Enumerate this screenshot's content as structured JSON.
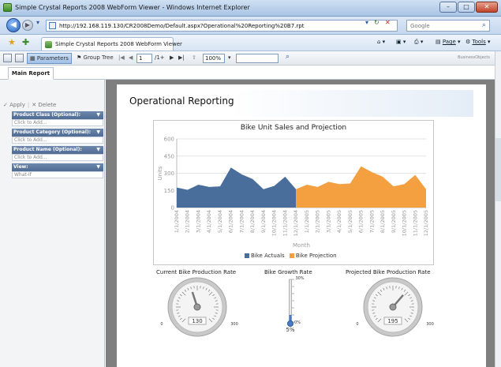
{
  "window": {
    "title": "Simple Crystal Reports 2008 WebForm Viewer - Windows Internet Explorer",
    "url": "http://192.168.119.130/CR2008Demo/Default.aspx?Operational%20Reporting%20B7.rpt",
    "search_placeholder": "Google",
    "tab_label": "Simple Crystal Reports 2008 WebForm Viewer",
    "cmd_page": "Page",
    "cmd_tools": "Tools"
  },
  "viewer_toolbar": {
    "parameters_label": "Parameters",
    "group_tree_label": "Group Tree",
    "page_value": "1",
    "page_total": "/1+",
    "zoom_value": "100%",
    "logo_prefix": "BusinessObjects",
    "logo_bold": ""
  },
  "tabs": {
    "main_report": "Main Report"
  },
  "left_panel": {
    "apply_label": "Apply",
    "delete_label": "Delete",
    "params": [
      {
        "header": "Product Class (Optional):",
        "value": "Click to Add..."
      },
      {
        "header": "Product Category (Optional):",
        "value": "Click to Add..."
      },
      {
        "header": "Product Name (Optional):",
        "value": "Click to Add..."
      },
      {
        "header": "View:",
        "value": "What-If"
      }
    ]
  },
  "report": {
    "title": "Operational Reporting"
  },
  "chart_data": {
    "type": "area",
    "title": "Bike Unit Sales and Projection",
    "xlabel": "Month",
    "ylabel": "Units",
    "ylim": [
      0,
      600
    ],
    "yticks": [
      0,
      150,
      300,
      450,
      600
    ],
    "grid": true,
    "legend_position": "bottom",
    "categories": [
      "1/1/2004",
      "2/1/2004",
      "3/1/2004",
      "4/1/2004",
      "5/1/2004",
      "6/1/2004",
      "7/1/2004",
      "8/1/2004",
      "9/1/2004",
      "10/1/2004",
      "11/1/2004",
      "12/1/2004",
      "1/1/2005",
      "2/1/2005",
      "3/1/2005",
      "4/1/2005",
      "5/1/2005",
      "6/1/2005",
      "7/1/2005",
      "8/1/2005",
      "9/1/2005",
      "10/1/2005",
      "11/1/2005",
      "12/1/2005"
    ],
    "series": [
      {
        "name": "Bike Actuals",
        "color": "#4a6e9b",
        "values": [
          175,
          155,
          200,
          180,
          185,
          350,
          290,
          250,
          160,
          190,
          270,
          160,
          null,
          null,
          null,
          null,
          null,
          null,
          null,
          null,
          null,
          null,
          null,
          null
        ]
      },
      {
        "name": "Bike Projection",
        "color": "#f5a040",
        "values": [
          null,
          null,
          null,
          null,
          null,
          null,
          null,
          null,
          null,
          null,
          null,
          160,
          200,
          180,
          225,
          205,
          210,
          360,
          310,
          270,
          185,
          205,
          285,
          160
        ]
      }
    ]
  },
  "gauges": [
    {
      "title": "Current Bike Production Rate",
      "min_label": "0",
      "max_label": "300",
      "value": 130,
      "value_label": "130",
      "max": 300
    },
    {
      "title": "Bike Growth Rate",
      "min_label": "0%",
      "max_label": "30%",
      "value": 5,
      "value_label": "5%",
      "max": 30
    },
    {
      "title": "Projected Bike Production Rate",
      "min_label": "0",
      "max_label": "300",
      "value": 195,
      "value_label": "195",
      "max": 300
    }
  ]
}
